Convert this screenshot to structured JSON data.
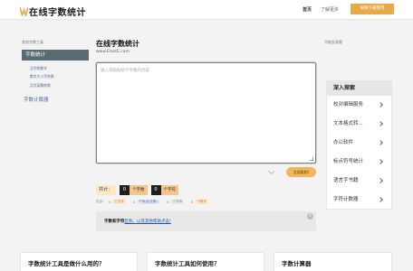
{
  "header": {
    "logo_text": "在线字数统计",
    "nav_home": "首页",
    "nav_more": "了解更多",
    "cta": "离线下载使用"
  },
  "left_sidebar": {
    "caption": "其他字数工具",
    "active": "字数统计",
    "sub_items": [
      "汉字和数字",
      "数字大小写转换",
      "汉字英繁转换"
    ],
    "item": "字数计算器"
  },
  "main": {
    "title": "在线字数统计",
    "url": "www.ElastE.com",
    "placeholder": "输入或粘贴统计字数的内容",
    "copy_button": "全部复制!",
    "stats": {
      "label": "共计：",
      "count1": "0",
      "unit1": "个字数",
      "count2": "0",
      "unit2": "个字符"
    },
    "details": [
      {
        "label": "包含：",
        "value": "0",
        "tag": "个汉字"
      },
      {
        "label": "",
        "value": "0",
        "tag": "个标点(全角)"
      },
      {
        "label": "",
        "value": "0",
        "tag": "个字母"
      },
      {
        "label": "",
        "value": "0",
        "tag": "个数字"
      }
    ],
    "notice": {
      "bold": "字数和字符",
      "text": "区别，以及其他帮助点击!"
    }
  },
  "right_sidebar": {
    "caption": "不能发表看",
    "explore_title": "深入探索",
    "items": [
      "校对编辑服务",
      "文本格式转...",
      "办公软件",
      "标点符号统计",
      "语言字书籍",
      "字符计数器"
    ]
  },
  "cards": [
    "字数统计工具是做什么用的？",
    "字数统计工具如何使用？",
    "字数计算器"
  ],
  "colors": {
    "accent": "#e8a94a",
    "active_sidebar": "#5a6b73",
    "link": "#4a6a9a"
  }
}
